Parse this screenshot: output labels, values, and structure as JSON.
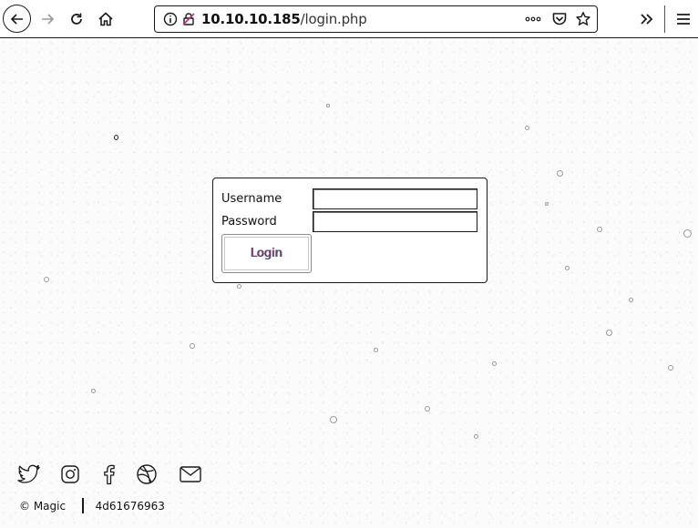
{
  "browser": {
    "url_host": "10.10.10.185",
    "url_path": "/login.php",
    "icons": [
      "back-icon",
      "forward-icon",
      "reload-icon",
      "home-icon",
      "site-info-icon",
      "insecure-lock-icon",
      "page-actions-icon",
      "pocket-icon",
      "bookmark-star-icon",
      "overflow-chevrons-icon",
      "menu-icon"
    ]
  },
  "login": {
    "username_label": "Username",
    "password_label": "Password",
    "username_value": "",
    "password_value": "",
    "submit_label": "Login"
  },
  "social": {
    "icons": [
      "twitter-icon",
      "instagram-icon",
      "facebook-icon",
      "dribbble-icon",
      "mail-icon"
    ]
  },
  "footer": {
    "copyright": "© Magic",
    "code": "4d61676963"
  },
  "colors": {
    "page_background": "#fbfbfb",
    "outline": "#1a1a1a"
  }
}
